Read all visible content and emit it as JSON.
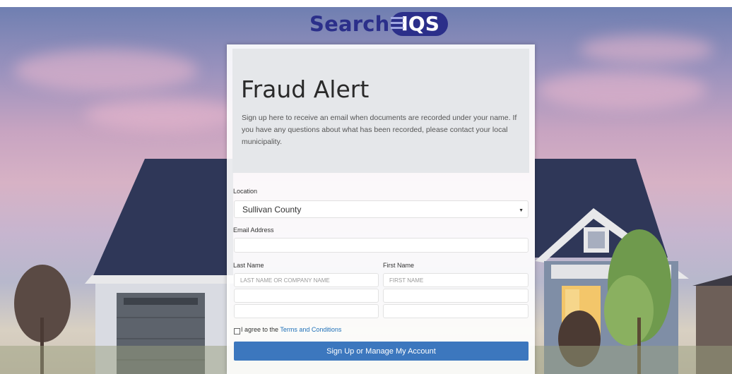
{
  "logo": {
    "text": "Search",
    "badge": "IQS"
  },
  "card": {
    "title": "Fraud Alert",
    "description": "Sign up here to receive an email when documents are recorded under your name. If you have any questions about what has been recorded, please contact your local municipality."
  },
  "form": {
    "location_label": "Location",
    "location_value": "Sullivan County",
    "email_label": "Email Address",
    "email_value": "",
    "last_name_label": "Last Name",
    "first_name_label": "First Name",
    "last_name_placeholder": "LAST NAME OR COMPANY NAME",
    "first_name_placeholder": "FIRST NAME",
    "agree_prefix": "I agree to the",
    "terms_link": "Terms and Conditions",
    "submit_label": "Sign Up or Manage My Account"
  },
  "colors": {
    "brand": "#2b2f8a",
    "button": "#3c77be"
  }
}
